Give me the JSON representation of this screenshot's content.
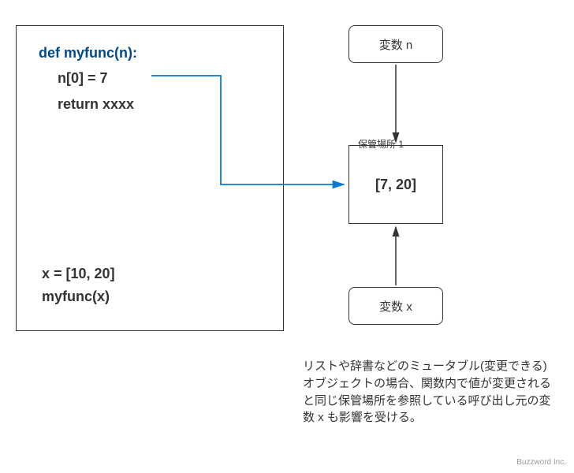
{
  "code": {
    "def_line": "def myfunc(n):",
    "body1": "n[0] = 7",
    "body2": "return xxxx",
    "bottom1": "x = [10, 20]",
    "bottom2": "myfunc(x)"
  },
  "var_n_label": "変数 n",
  "var_x_label": "変数 x",
  "storage": {
    "label": "保管場所 1",
    "value": "[7, 20]"
  },
  "note_text": "リストや辞書などのミュータブル(変更できる)オブジェクトの場合、関数内で値が変更されると同じ保管場所を参照している呼び出し元の変数 x も影響を受ける。",
  "credit": "Buzzword Inc."
}
